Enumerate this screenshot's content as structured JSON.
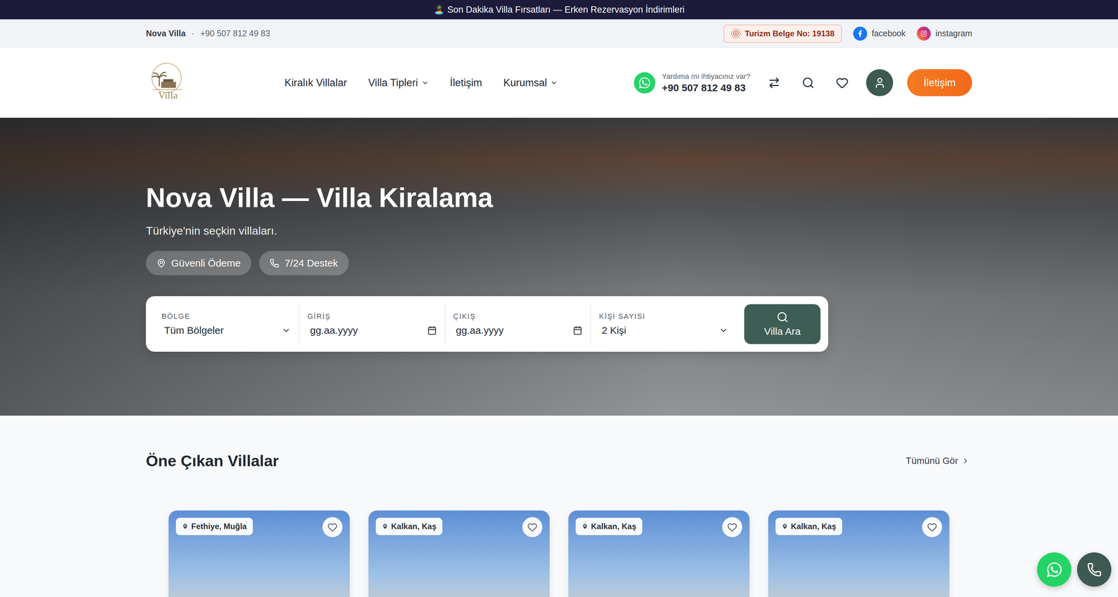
{
  "announcement": {
    "text": "🏝️ Son Dakika Villa Fırsatları — Erken Rezervasyon İndirimleri"
  },
  "info_bar": {
    "brand": "Nova Villa",
    "separator": "·",
    "phone": "+90 507 812 49 83",
    "license": "Turizm Belge No: 19138",
    "socials": [
      {
        "name": "facebook",
        "kind": "facebook"
      },
      {
        "name": "instagram",
        "kind": "instagram"
      }
    ]
  },
  "header": {
    "logo": {
      "text": "Villa"
    },
    "nav": [
      {
        "label": "Kiralık Villalar",
        "dropdown": false
      },
      {
        "label": "Villa Tipleri",
        "dropdown": true
      },
      {
        "label": "İletişim",
        "dropdown": false
      },
      {
        "label": "Kurumsal",
        "dropdown": true
      }
    ],
    "help": {
      "label": "Yardıma mı ihtiyacınız var?",
      "phone": "+90 507 812 49 83"
    },
    "cta": "İletişim"
  },
  "hero": {
    "title": "Nova Villa — Villa Kiralama",
    "subtitle": "Türkiye'nin seçkin villaları.",
    "badges": [
      {
        "label": "Güvenli Ödeme",
        "kind": "location"
      },
      {
        "label": "7/24 Destek",
        "kind": "phone"
      }
    ]
  },
  "search": {
    "fields": [
      {
        "label": "BÖLGE",
        "value": "Tüm Bölgeler",
        "kind": "select"
      },
      {
        "label": "GİRİŞ",
        "value": "gg.aa.yyyy",
        "kind": "date"
      },
      {
        "label": "ÇIKIŞ",
        "value": "gg.aa.yyyy",
        "kind": "date"
      },
      {
        "label": "KİŞİ SAYISI",
        "value": "2 Kişi",
        "kind": "select"
      }
    ],
    "button": "Villa Ara"
  },
  "featured": {
    "title": "Öne Çıkan Villalar",
    "link": "Tümünü Gör",
    "cards": [
      {
        "location": "Fethiye, Muğla",
        "favorite": false
      },
      {
        "location": "Kalkan, Kaş",
        "favorite": false
      },
      {
        "location": "Kalkan, Kaş",
        "favorite": false
      },
      {
        "location": "Kalkan, Kaş",
        "favorite": false
      }
    ]
  }
}
